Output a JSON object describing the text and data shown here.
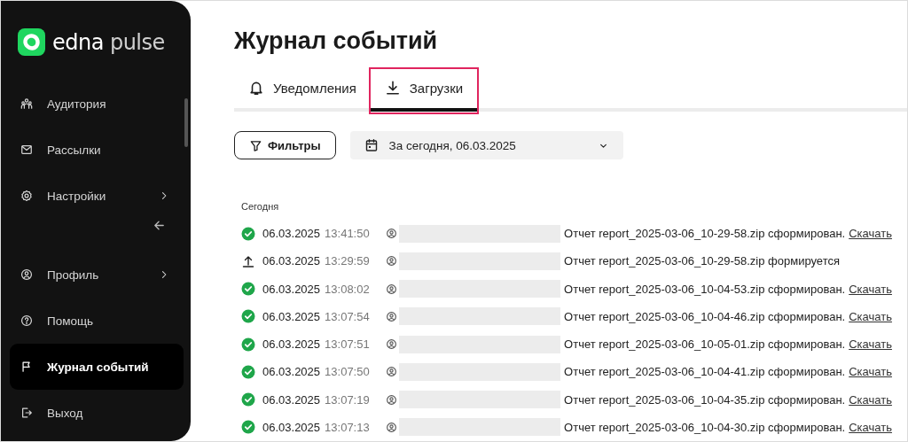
{
  "logo": {
    "brand": "edna",
    "product": "pulse"
  },
  "sidebar": {
    "items": [
      {
        "label": "Аудитория",
        "has_submenu": false,
        "selected": false
      },
      {
        "label": "Рассылки",
        "has_submenu": false,
        "selected": false
      },
      {
        "label": "Настройки",
        "has_submenu": true,
        "selected": false
      },
      {
        "label": "Профиль",
        "has_submenu": true,
        "selected": false
      },
      {
        "label": "Помощь",
        "has_submenu": false,
        "selected": false
      },
      {
        "label": "Журнал событий",
        "has_submenu": false,
        "selected": true
      },
      {
        "label": "Выход",
        "has_submenu": false,
        "selected": false
      }
    ]
  },
  "page_title": "Журнал событий",
  "tabs": [
    {
      "label": "Уведомления",
      "selected": false,
      "highlighted": false
    },
    {
      "label": "Загрузки",
      "selected": true,
      "highlighted": true
    }
  ],
  "filters": {
    "button": "Фильтры",
    "date_range": "За сегодня, 06.03.2025"
  },
  "group_label": "Сегодня",
  "events": [
    {
      "kind": "done",
      "date": "06.03.2025",
      "time": "13:41:50",
      "message": "Отчет report_2025-03-06_10-29-58.zip сформирован.",
      "link": "Скачать"
    },
    {
      "kind": "uploading",
      "date": "06.03.2025",
      "time": "13:29:59",
      "message": "Отчет report_2025-03-06_10-29-58.zip формируется"
    },
    {
      "kind": "done",
      "date": "06.03.2025",
      "time": "13:08:02",
      "message": "Отчет report_2025-03-06_10-04-53.zip сформирован.",
      "link": "Скачать"
    },
    {
      "kind": "done",
      "date": "06.03.2025",
      "time": "13:07:54",
      "message": "Отчет report_2025-03-06_10-04-46.zip сформирован.",
      "link": "Скачать"
    },
    {
      "kind": "done",
      "date": "06.03.2025",
      "time": "13:07:51",
      "message": "Отчет report_2025-03-06_10-05-01.zip сформирован.",
      "link": "Скачать"
    },
    {
      "kind": "done",
      "date": "06.03.2025",
      "time": "13:07:50",
      "message": "Отчет report_2025-03-06_10-04-41.zip сформирован.",
      "link": "Скачать"
    },
    {
      "kind": "done",
      "date": "06.03.2025",
      "time": "13:07:19",
      "message": "Отчет report_2025-03-06_10-04-35.zip сформирован.",
      "link": "Скачать"
    },
    {
      "kind": "done",
      "date": "06.03.2025",
      "time": "13:07:13",
      "message": "Отчет report_2025-03-06_10-04-30.zip сформирован.",
      "link": "Скачать"
    }
  ]
}
